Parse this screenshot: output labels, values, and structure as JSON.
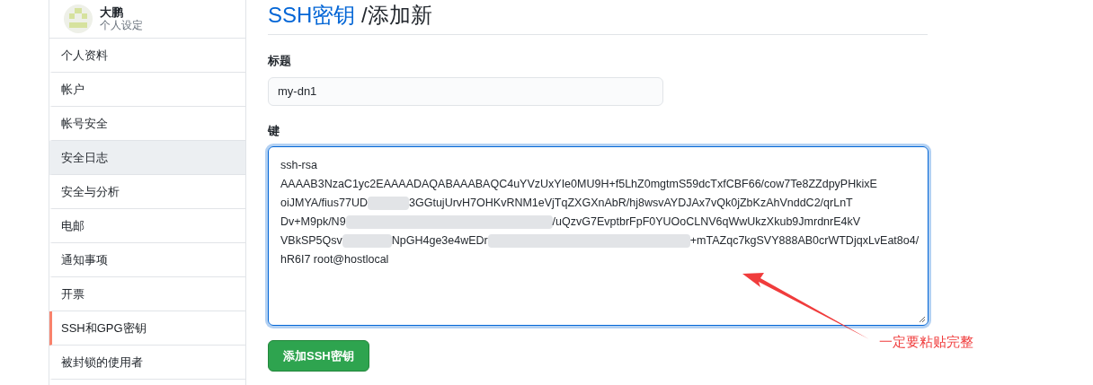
{
  "profile": {
    "name": "大鹏",
    "subtitle": "个人设定"
  },
  "sidebar": {
    "items": [
      {
        "label": "个人资料",
        "selected": false,
        "hovered": false
      },
      {
        "label": "帐户",
        "selected": false,
        "hovered": false
      },
      {
        "label": "帐号安全",
        "selected": false,
        "hovered": false
      },
      {
        "label": "安全日志",
        "selected": false,
        "hovered": true
      },
      {
        "label": "安全与分析",
        "selected": false,
        "hovered": false
      },
      {
        "label": "电邮",
        "selected": false,
        "hovered": false
      },
      {
        "label": "通知事项",
        "selected": false,
        "hovered": false
      },
      {
        "label": "开票",
        "selected": false,
        "hovered": false
      },
      {
        "label": "SSH和GPG密钥",
        "selected": true,
        "hovered": false
      },
      {
        "label": "被封锁的使用者",
        "selected": false,
        "hovered": false
      }
    ]
  },
  "page_title": {
    "link": "SSH密钥",
    "rest": " /添加新"
  },
  "title_field": {
    "label": "标题",
    "value": "my-dn1"
  },
  "key_field": {
    "label": "键",
    "lines": [
      [
        "ssh-rsa"
      ],
      [
        "AAAAB3NzaC1yc2EAAAADAQABAAABAQC4uYVzUxYIe0MU9H+f5LhZ0mgtmS59dcTxfCBF66/cow7Te8ZZdpyPHkixE"
      ],
      [
        "oiJMYA/fius77UD",
        "3GGtujUrvH7OHKvRNM1eVjTqZXGXnAbR/hj8wsvAYDJAx7vQk0jZbKzAhVnddC2/qrLnT"
      ],
      [
        "Dv+M9pk/N9",
        "/uQzvG7EvptbrFpF0YUOoCLNV6qWwUkzXkub9JmrdnrE4kV"
      ],
      [
        "VBkSP5Qsv",
        "NpGH4ge3e4wEDr",
        "+mTAZqc7kgSVY888AB0crWTDjqxLvEat8o4/"
      ],
      [
        "hR6I7 root@hostlocal"
      ]
    ]
  },
  "submit_button": "添加SSH密钥",
  "annotation": "一定要粘贴完整"
}
